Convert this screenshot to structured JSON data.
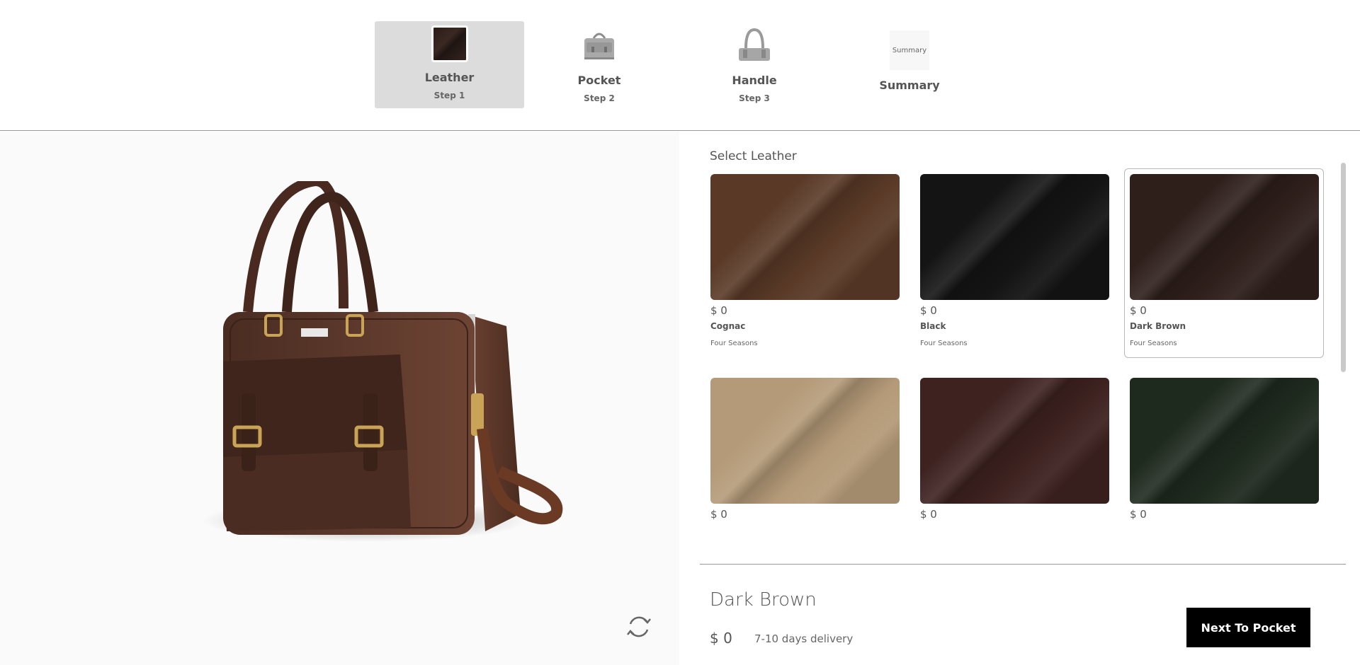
{
  "steps": [
    {
      "title": "Leather",
      "sub": "Step 1",
      "icon": "leather-swatch-icon",
      "active": true
    },
    {
      "title": "Pocket",
      "sub": "Step 2",
      "icon": "bag-pocket-icon"
    },
    {
      "title": "Handle",
      "sub": "Step 3",
      "icon": "bag-handle-icon"
    },
    {
      "title": "Summary",
      "thumb_text": "Summary",
      "icon": "summary-thumb"
    }
  ],
  "panel": {
    "title": "Select Leather",
    "cards": [
      {
        "price": "$ 0",
        "name": "Cognac",
        "season": "Four Seasons",
        "color": "#5a3a27"
      },
      {
        "price": "$ 0",
        "name": "Black",
        "season": "Four Seasons",
        "color": "#141414"
      },
      {
        "price": "$ 0",
        "name": "Dark Brown",
        "season": "Four Seasons",
        "color": "#2e1f1b",
        "selected": true
      },
      {
        "price": "$ 0",
        "name": "",
        "season": "",
        "color": "#b49a78"
      },
      {
        "price": "$ 0",
        "name": "",
        "season": "",
        "color": "#3d2220"
      },
      {
        "price": "$ 0",
        "name": "",
        "season": "",
        "color": "#1f2a1f"
      }
    ]
  },
  "footer": {
    "selected_name": "Dark Brown",
    "price": "$ 0",
    "delivery": "7-10 days delivery",
    "next_label": "Next To Pocket"
  },
  "viewer": {
    "product_icon": "briefcase-bag-image",
    "rotate_icon": "rotate-icon"
  }
}
